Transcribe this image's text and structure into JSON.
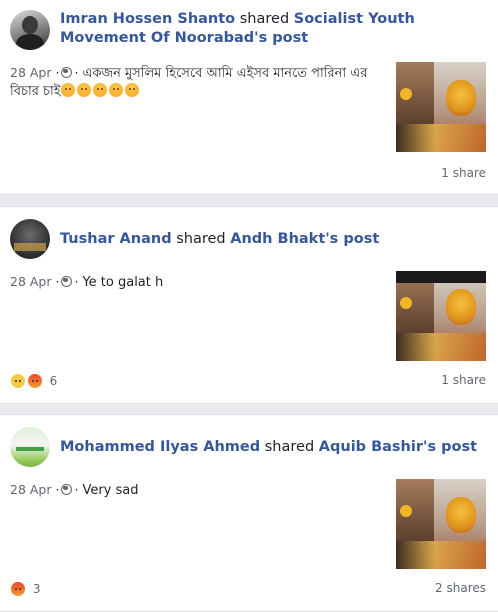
{
  "posts": [
    {
      "author": "Imran Hossen Shanto",
      "verb": "shared",
      "source": "Socialist Youth Movement Of Noorabad's post",
      "date": "28 Apr",
      "text": "একজন মুসলিম হিসেবে আমি এইসব মানতে পারিনা এর বিচার চাই",
      "emoji_count": 5,
      "emoji_name": "angry-face-emoji",
      "shares": "1 share"
    },
    {
      "author": "Tushar Anand",
      "verb": "shared",
      "source": "Andh Bhakt's post",
      "date": "28 Apr",
      "text": "Ye to galat h",
      "reactions": [
        "sad",
        "angry"
      ],
      "reaction_count": "6",
      "shares": "1 share"
    },
    {
      "author": "Mohammed Ilyas Ahmed",
      "verb": "shared",
      "source": "Aquib Bashir's post",
      "date": "28 Apr",
      "text": "Very sad",
      "reactions": [
        "angry"
      ],
      "reaction_count": "3",
      "shares": "2 shares"
    }
  ],
  "colors": {
    "link": "#365899",
    "meta": "#606770",
    "background": "#e9ebee"
  },
  "icons": {
    "privacy": "globe-icon"
  }
}
